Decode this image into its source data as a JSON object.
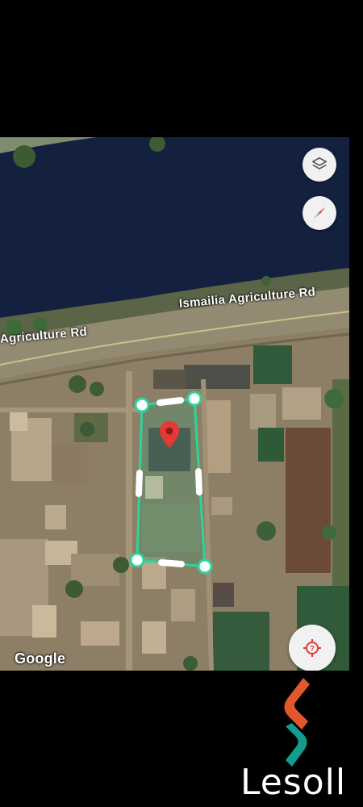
{
  "map": {
    "road_label_primary": "Ismailia Agriculture Rd",
    "road_label_secondary": "Agriculture Rd",
    "attribution": "Google",
    "map_type": "satellite",
    "accent_color": "#2fd39a",
    "marker_color": "#e53935"
  },
  "controls": {
    "layers_icon": "layers-icon",
    "compass_icon": "compass-icon",
    "locate_icon": "my-location-icon"
  },
  "branding": {
    "name": "Lesoll",
    "colors": [
      "#e2572c",
      "#159b8e"
    ]
  }
}
